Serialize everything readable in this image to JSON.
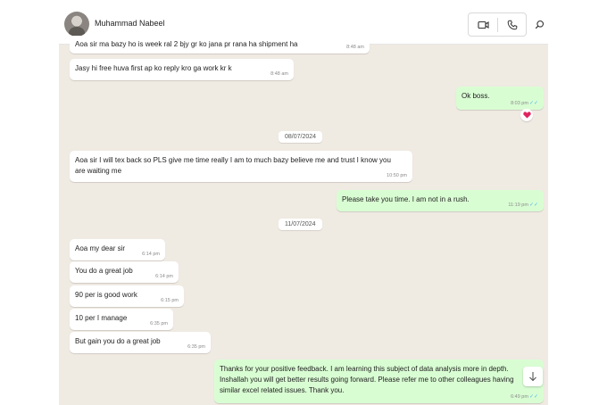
{
  "header": {
    "contact_name": "Muhammad Nabeel",
    "icons": [
      "avatar",
      "video-call-icon",
      "voice-call-icon",
      "search-icon"
    ]
  },
  "dates": [
    "08/07/2024",
    "11/07/2024"
  ],
  "messages": [
    {
      "dir": "in",
      "text": "Aoa sir ma bazy ho is week ral 2 bjy gr ko jana pr rana ha shipment ha",
      "time": "8:48 am"
    },
    {
      "dir": "in",
      "text": "Jasy hi free huva first ap ko reply kro ga work kr k",
      "time": "8:48 am"
    },
    {
      "dir": "out",
      "text": "Ok boss.",
      "time": "8:03 pm"
    },
    {
      "dir": "in",
      "text": "Aoa sir I will tex back so PLS give me time really I am to much bazy believe me and trust I know you are waiting me",
      "time": "10:50 pm"
    },
    {
      "dir": "out",
      "text": "Please take you time. I am not in a rush.",
      "time": "11:19 pm"
    },
    {
      "dir": "in",
      "text": "Aoa my dear sir",
      "time": "6:14 pm"
    },
    {
      "dir": "in",
      "text": "You do a great job",
      "time": "6:14 pm"
    },
    {
      "dir": "in",
      "text": "90 per is good work",
      "time": "6:15 pm"
    },
    {
      "dir": "in",
      "text": "10 per I manage",
      "time": "6:35 pm"
    },
    {
      "dir": "in",
      "text": "But gain you do a great job",
      "time": "6:35 pm"
    },
    {
      "dir": "out",
      "text": "Thanks for your positive feedback. I am learning this subject of data analysis more in depth. Inshallah you will get better results going forward. Please refer me to other colleagues having similar excel related issues. Thank you.",
      "time": "6:49 pm"
    }
  ],
  "reaction": {
    "emoji": "heart",
    "color": "#e0245e"
  },
  "colors": {
    "outgoing_bubble": "#d9fdd3",
    "incoming_bubble": "#ffffff",
    "chat_background": "#efeae2",
    "read_ticks": "#53bdeb"
  }
}
